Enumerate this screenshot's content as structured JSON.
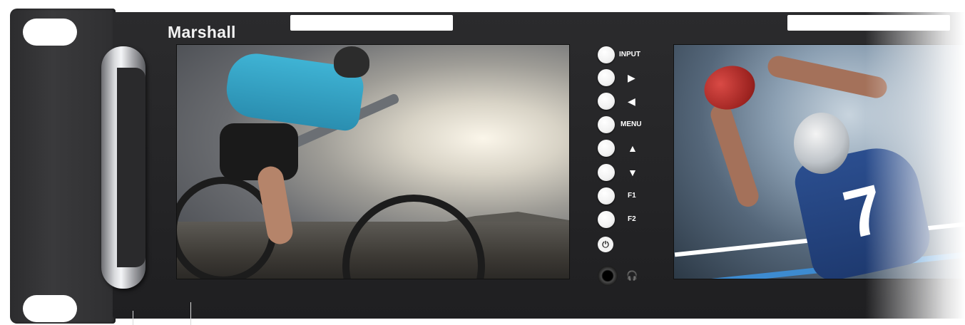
{
  "device": {
    "brand": "Marshall"
  },
  "controls": {
    "input_label": "INPUT",
    "right_glyph": "▶",
    "left_glyph": "◀",
    "menu_label": "MENU",
    "up_glyph": "▲",
    "down_glyph": "▼",
    "f1_label": "F1",
    "f2_label": "F2",
    "power_glyph": "⏻",
    "headphone_glyph": "🎧"
  },
  "screens": {
    "left_content": "mountain-biker-image",
    "right_content": "football-player-image",
    "right_jersey_number": "7"
  },
  "colors": {
    "chassis": "#262628",
    "button_face": "#f1f1f1",
    "label_text": "#ffffff"
  }
}
